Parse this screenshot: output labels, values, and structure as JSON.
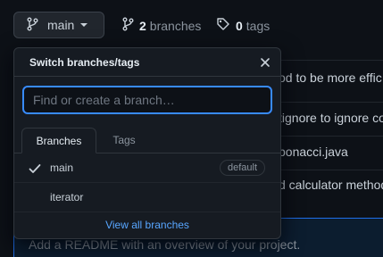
{
  "toolbar": {
    "branch_button_label": "main",
    "branches_count": "2",
    "branches_label": "branches",
    "tags_count": "0",
    "tags_label": "tags"
  },
  "background_rows": [
    "od to be more effic",
    "tignore to ignore co",
    "bonacci.java",
    "d calculator method"
  ],
  "readme_prompt": "Add a README with an overview of your project.",
  "branch_menu": {
    "title": "Switch branches/tags",
    "search_placeholder": "Find or create a branch…",
    "tabs": [
      "Branches",
      "Tags"
    ],
    "items": [
      {
        "label": "main",
        "badge": "default",
        "selected": true
      },
      {
        "label": "iterator",
        "badge": "",
        "selected": false
      }
    ],
    "view_all_label": "View all branches"
  },
  "colors": {
    "background": "#0d1117",
    "popover": "#161b22",
    "accent": "#58a6ff",
    "focus_border": "#388bfd"
  }
}
